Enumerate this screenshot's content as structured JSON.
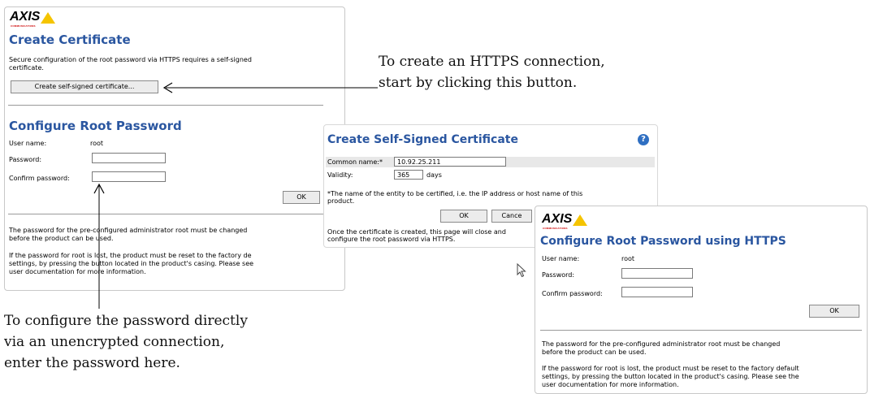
{
  "left_panel": {
    "logo_text": "AXIS",
    "logo_subtext": "COMMUNICATIONS",
    "create_cert_title": "Create Certificate",
    "create_cert_text_line1": "Secure configuration of the root password via HTTPS requires a self-signed",
    "create_cert_text_line2": "certificate.",
    "create_cert_button": "Create self-signed certificate...",
    "root_pw_title": "Configure Root Password",
    "username_label": "User name:",
    "username_value": "root",
    "password_label": "Password:",
    "confirm_label": "Confirm password:",
    "ok_button": "OK",
    "note1_line1": "The password for the pre-configured administrator root must be changed",
    "note1_line2": "before the product can be used.",
    "note2_line1": "If the password for root is lost, the product must be reset to the factory de",
    "note2_line2": "settings, by pressing the button located in the product's casing. Please see",
    "note2_line3": "user documentation for more information."
  },
  "self_signed_dialog": {
    "title": "Create Self-Signed Certificate",
    "help_icon": "?",
    "common_name_label": "Common name:*",
    "common_name_value": "10.92.25.211",
    "validity_label": "Validity:",
    "validity_value": "365",
    "validity_unit": "days",
    "footnote_line1": "*The name of the entity to be certified, i.e. the IP address or host name of this",
    "footnote_line2": "product.",
    "ok_button": "OK",
    "cancel_button": "Cance",
    "info_line1": "Once the certificate is created, this page will close and",
    "info_line2": "configure the root password via HTTPS."
  },
  "https_panel": {
    "logo_text": "AXIS",
    "logo_subtext": "COMMUNICATIONS",
    "title": "Configure Root Password using HTTPS",
    "username_label": "User name:",
    "username_value": "root",
    "password_label": "Password:",
    "confirm_label": "Confirm password:",
    "ok_button": "OK",
    "note1_line1": "The password for the pre-configured administrator root must be changed",
    "note1_line2": "before the product can be used.",
    "note2_line1": "If the password for root is lost, the product must be reset to the factory default",
    "note2_line2": "settings, by pressing the button located in the product's casing. Please see the",
    "note2_line3": "user documentation for more information."
  },
  "callouts": {
    "https_line1": "To create an HTTPS connection,",
    "https_line2": "start by clicking this button.",
    "direct_line1": "To configure the password directly",
    "direct_line2": "via an unencrypted connection,",
    "direct_line3": "enter the password here."
  },
  "colors": {
    "heading_blue": "#2a56a0",
    "logo_yellow": "#f5c400",
    "help_icon_blue": "#2f6fc2"
  }
}
